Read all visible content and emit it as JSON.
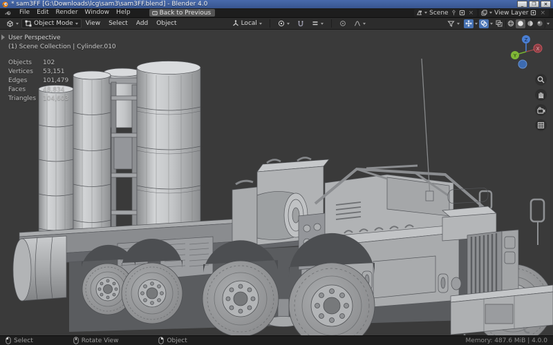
{
  "window": {
    "title": "* sam3FF [G:\\Downloads\\lcg\\sam3\\sam3FF.blend] - Blender 4.0",
    "controls": {
      "minimize": "_",
      "restore": "❐",
      "close": "×"
    }
  },
  "menubar": {
    "items": [
      "File",
      "Edit",
      "Render",
      "Window",
      "Help"
    ],
    "back_button": "Back to Previous",
    "scene_selector": {
      "value": "Scene"
    },
    "view_layer_selector": {
      "value": "View Layer"
    }
  },
  "tool_header": {
    "mode_selector": "Object Mode",
    "menus": [
      "View",
      "Select",
      "Add",
      "Object"
    ],
    "orientation": "Local"
  },
  "viewport": {
    "view_label": "User Perspective",
    "context_label": "(1) Scene Collection | Cylinder.010",
    "stats": [
      {
        "label": "Objects",
        "value": "102"
      },
      {
        "label": "Vertices",
        "value": "53,151"
      },
      {
        "label": "Edges",
        "value": "101,479"
      },
      {
        "label": "Faces",
        "value": "48,834"
      },
      {
        "label": "Triangles",
        "value": "104,603"
      }
    ],
    "gizmo": {
      "x": "X",
      "y": "Y",
      "z": "Z"
    }
  },
  "statusbar": {
    "select": "Select",
    "rotate_view": "Rotate View",
    "object": "Object",
    "memory": "Memory: 487.6 MiB | 4.0.0"
  },
  "colors": {
    "titlebar_blue": "#486aab",
    "accent_blue": "#4772b3",
    "viewport_bg": "#3a3a3a",
    "model_gray": "#b0b2b4"
  }
}
